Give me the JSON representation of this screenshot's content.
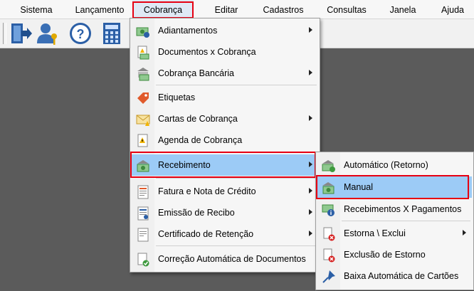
{
  "menubar": {
    "items": [
      "Sistema",
      "Lançamento",
      "Cobrança",
      "Editar",
      "Cadastros",
      "Consultas",
      "Janela",
      "Ajuda"
    ]
  },
  "toolbar": {
    "buttons": [
      "exit-door-icon",
      "user-key-icon",
      "help-icon",
      "calculator-icon"
    ]
  },
  "cobranca_menu": {
    "items": [
      {
        "label": "Adiantamentos",
        "submenu": true,
        "icon": "money-dollar-icon"
      },
      {
        "label": "Documentos x Cobrança",
        "submenu": false,
        "icon": "document-money-icon"
      },
      {
        "label": "Cobrança Bancária",
        "submenu": true,
        "icon": "bank-money-icon"
      },
      {
        "label": "Etiquetas",
        "submenu": false,
        "icon": "price-tag-icon"
      },
      {
        "label": "Cartas de Cobrança",
        "submenu": true,
        "icon": "letter-warning-icon"
      },
      {
        "label": "Agenda de Cobrança",
        "submenu": false,
        "icon": "agenda-warning-icon"
      },
      {
        "label": "Recebimento",
        "submenu": true,
        "icon": "receive-money-icon"
      },
      {
        "label": "Fatura e Nota de Crédito",
        "submenu": true,
        "icon": "invoice-icon"
      },
      {
        "label": "Emissão de Recibo",
        "submenu": true,
        "icon": "receipt-icon"
      },
      {
        "label": "Certificado de Retenção",
        "submenu": true,
        "icon": "certificate-icon"
      },
      {
        "label": "Correção Automática de Documentos",
        "submenu": false,
        "icon": "document-check-icon"
      }
    ]
  },
  "recebimento_menu": {
    "items": [
      {
        "label": "Automático (Retorno)",
        "submenu": false,
        "icon": "auto-return-icon"
      },
      {
        "label": "Manual",
        "submenu": false,
        "icon": "manual-money-icon"
      },
      {
        "label": "Recebimentos X Pagamentos",
        "submenu": false,
        "icon": "receipts-payments-icon"
      },
      {
        "label": "Estorna \\ Exclui",
        "submenu": true,
        "icon": "doc-delete-icon"
      },
      {
        "label": "Exclusão de Estorno",
        "submenu": false,
        "icon": "doc-delete-icon"
      },
      {
        "label": "Baixa Automática de Cartões",
        "submenu": false,
        "icon": "pushpin-icon"
      }
    ]
  },
  "colors": {
    "highlight": "#9ccbf6",
    "annotation": "#e60012",
    "workspace": "#5b5b5b"
  }
}
